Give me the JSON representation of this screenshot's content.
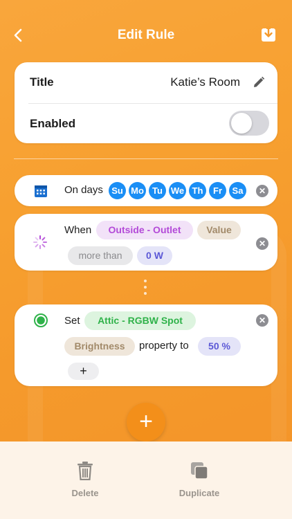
{
  "header": {
    "title": "Edit Rule"
  },
  "settings": {
    "title_label": "Title",
    "title_value": "Katie’s Room",
    "enabled_label": "Enabled",
    "enabled": false
  },
  "schedule": {
    "prefix": "On days",
    "days": [
      "Su",
      "Mo",
      "Tu",
      "We",
      "Th",
      "Fr",
      "Sa"
    ]
  },
  "condition": {
    "prefix": "When",
    "device": "Outside - Outlet",
    "attribute": "Value",
    "comparator": "more than",
    "threshold": "0 W"
  },
  "action": {
    "prefix": "Set",
    "device": "Attic - RGBW  Spot",
    "property": "Brightness",
    "connector": "property to",
    "value": "50 %",
    "add_symbol": "+"
  },
  "fab": {
    "symbol": "+"
  },
  "bottom_bar": {
    "delete_label": "Delete",
    "duplicate_label": "Duplicate"
  },
  "colors": {
    "accent": "#f38f1a",
    "day_blue": "#1a8ef5",
    "purple": "#b34ad8",
    "green": "#2fb24a",
    "tan": "#a28a6a",
    "indigo": "#5b58d6"
  }
}
